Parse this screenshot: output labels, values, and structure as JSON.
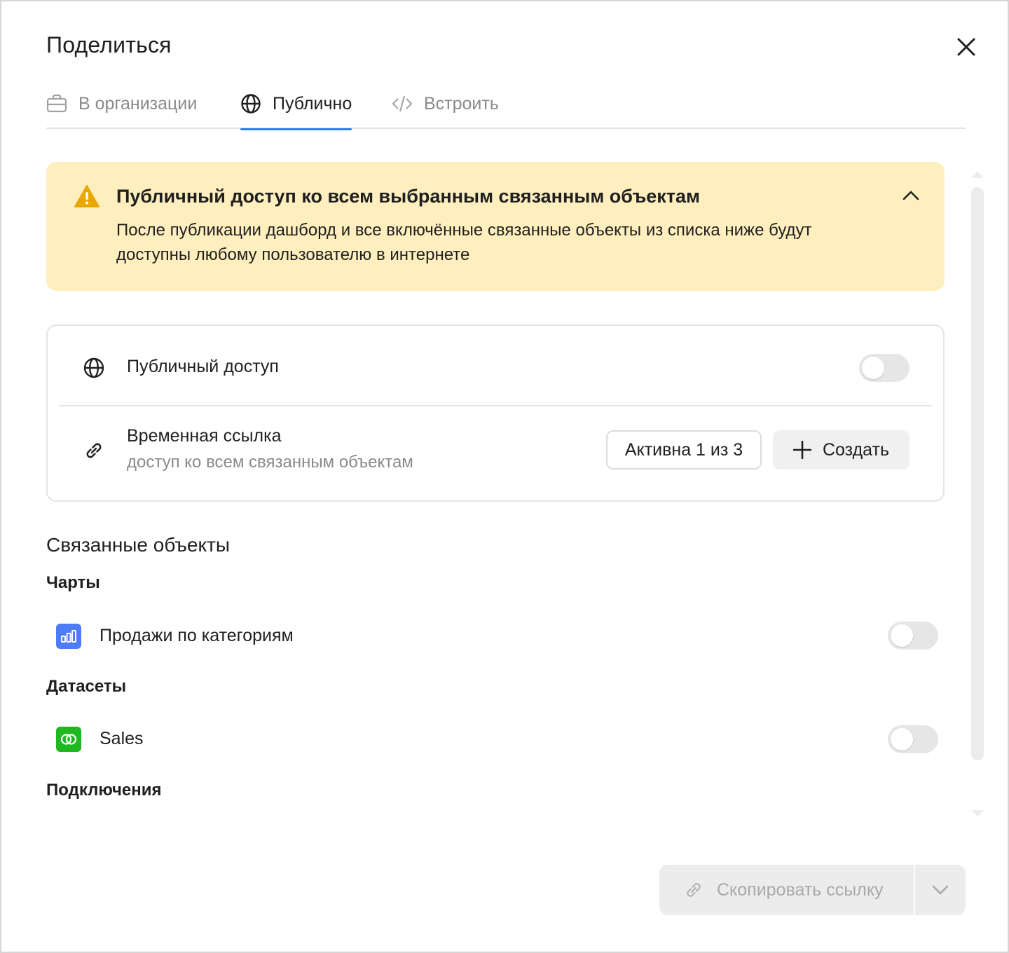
{
  "dialog": {
    "title": "Поделиться",
    "close_icon": "close-icon"
  },
  "tabs": [
    {
      "label": "В организации",
      "icon": "briefcase-icon",
      "active": false
    },
    {
      "label": "Публично",
      "icon": "globe-icon",
      "active": true
    },
    {
      "label": "Встроить",
      "icon": "code-icon",
      "active": false
    }
  ],
  "alert": {
    "title": "Публичный доступ ко всем выбранным связанным объектам",
    "line1": "После публикации дашборд и все включённые связанные объекты из списка ниже будут",
    "line2": "доступны любому пользователю в интернете",
    "icon": "warning-icon",
    "color_bg": "#ffefbf",
    "color_icon": "#e8a800"
  },
  "public_access": {
    "label": "Публичный доступ",
    "enabled": false
  },
  "temp_link": {
    "label": "Временная ссылка",
    "sub": "доступ ко всем связанным объектам",
    "active_button": "Активна 1 из 3",
    "create_button": "Создать"
  },
  "linked": {
    "title": "Связанные объекты",
    "groups": [
      {
        "title": "Чарты",
        "items": [
          {
            "label": "Продажи по категориям",
            "icon": "chart-icon",
            "icon_color": "#4d7cf6",
            "enabled": false
          }
        ]
      },
      {
        "title": "Датасеты",
        "items": [
          {
            "label": "Sales",
            "icon": "dataset-icon",
            "icon_color": "#1fb81f",
            "enabled": false
          }
        ]
      },
      {
        "title": "Подключения",
        "items": []
      }
    ]
  },
  "footer": {
    "copy_button": "Скопировать ссылку"
  },
  "colors": {
    "accent": "#2f7fe0"
  }
}
